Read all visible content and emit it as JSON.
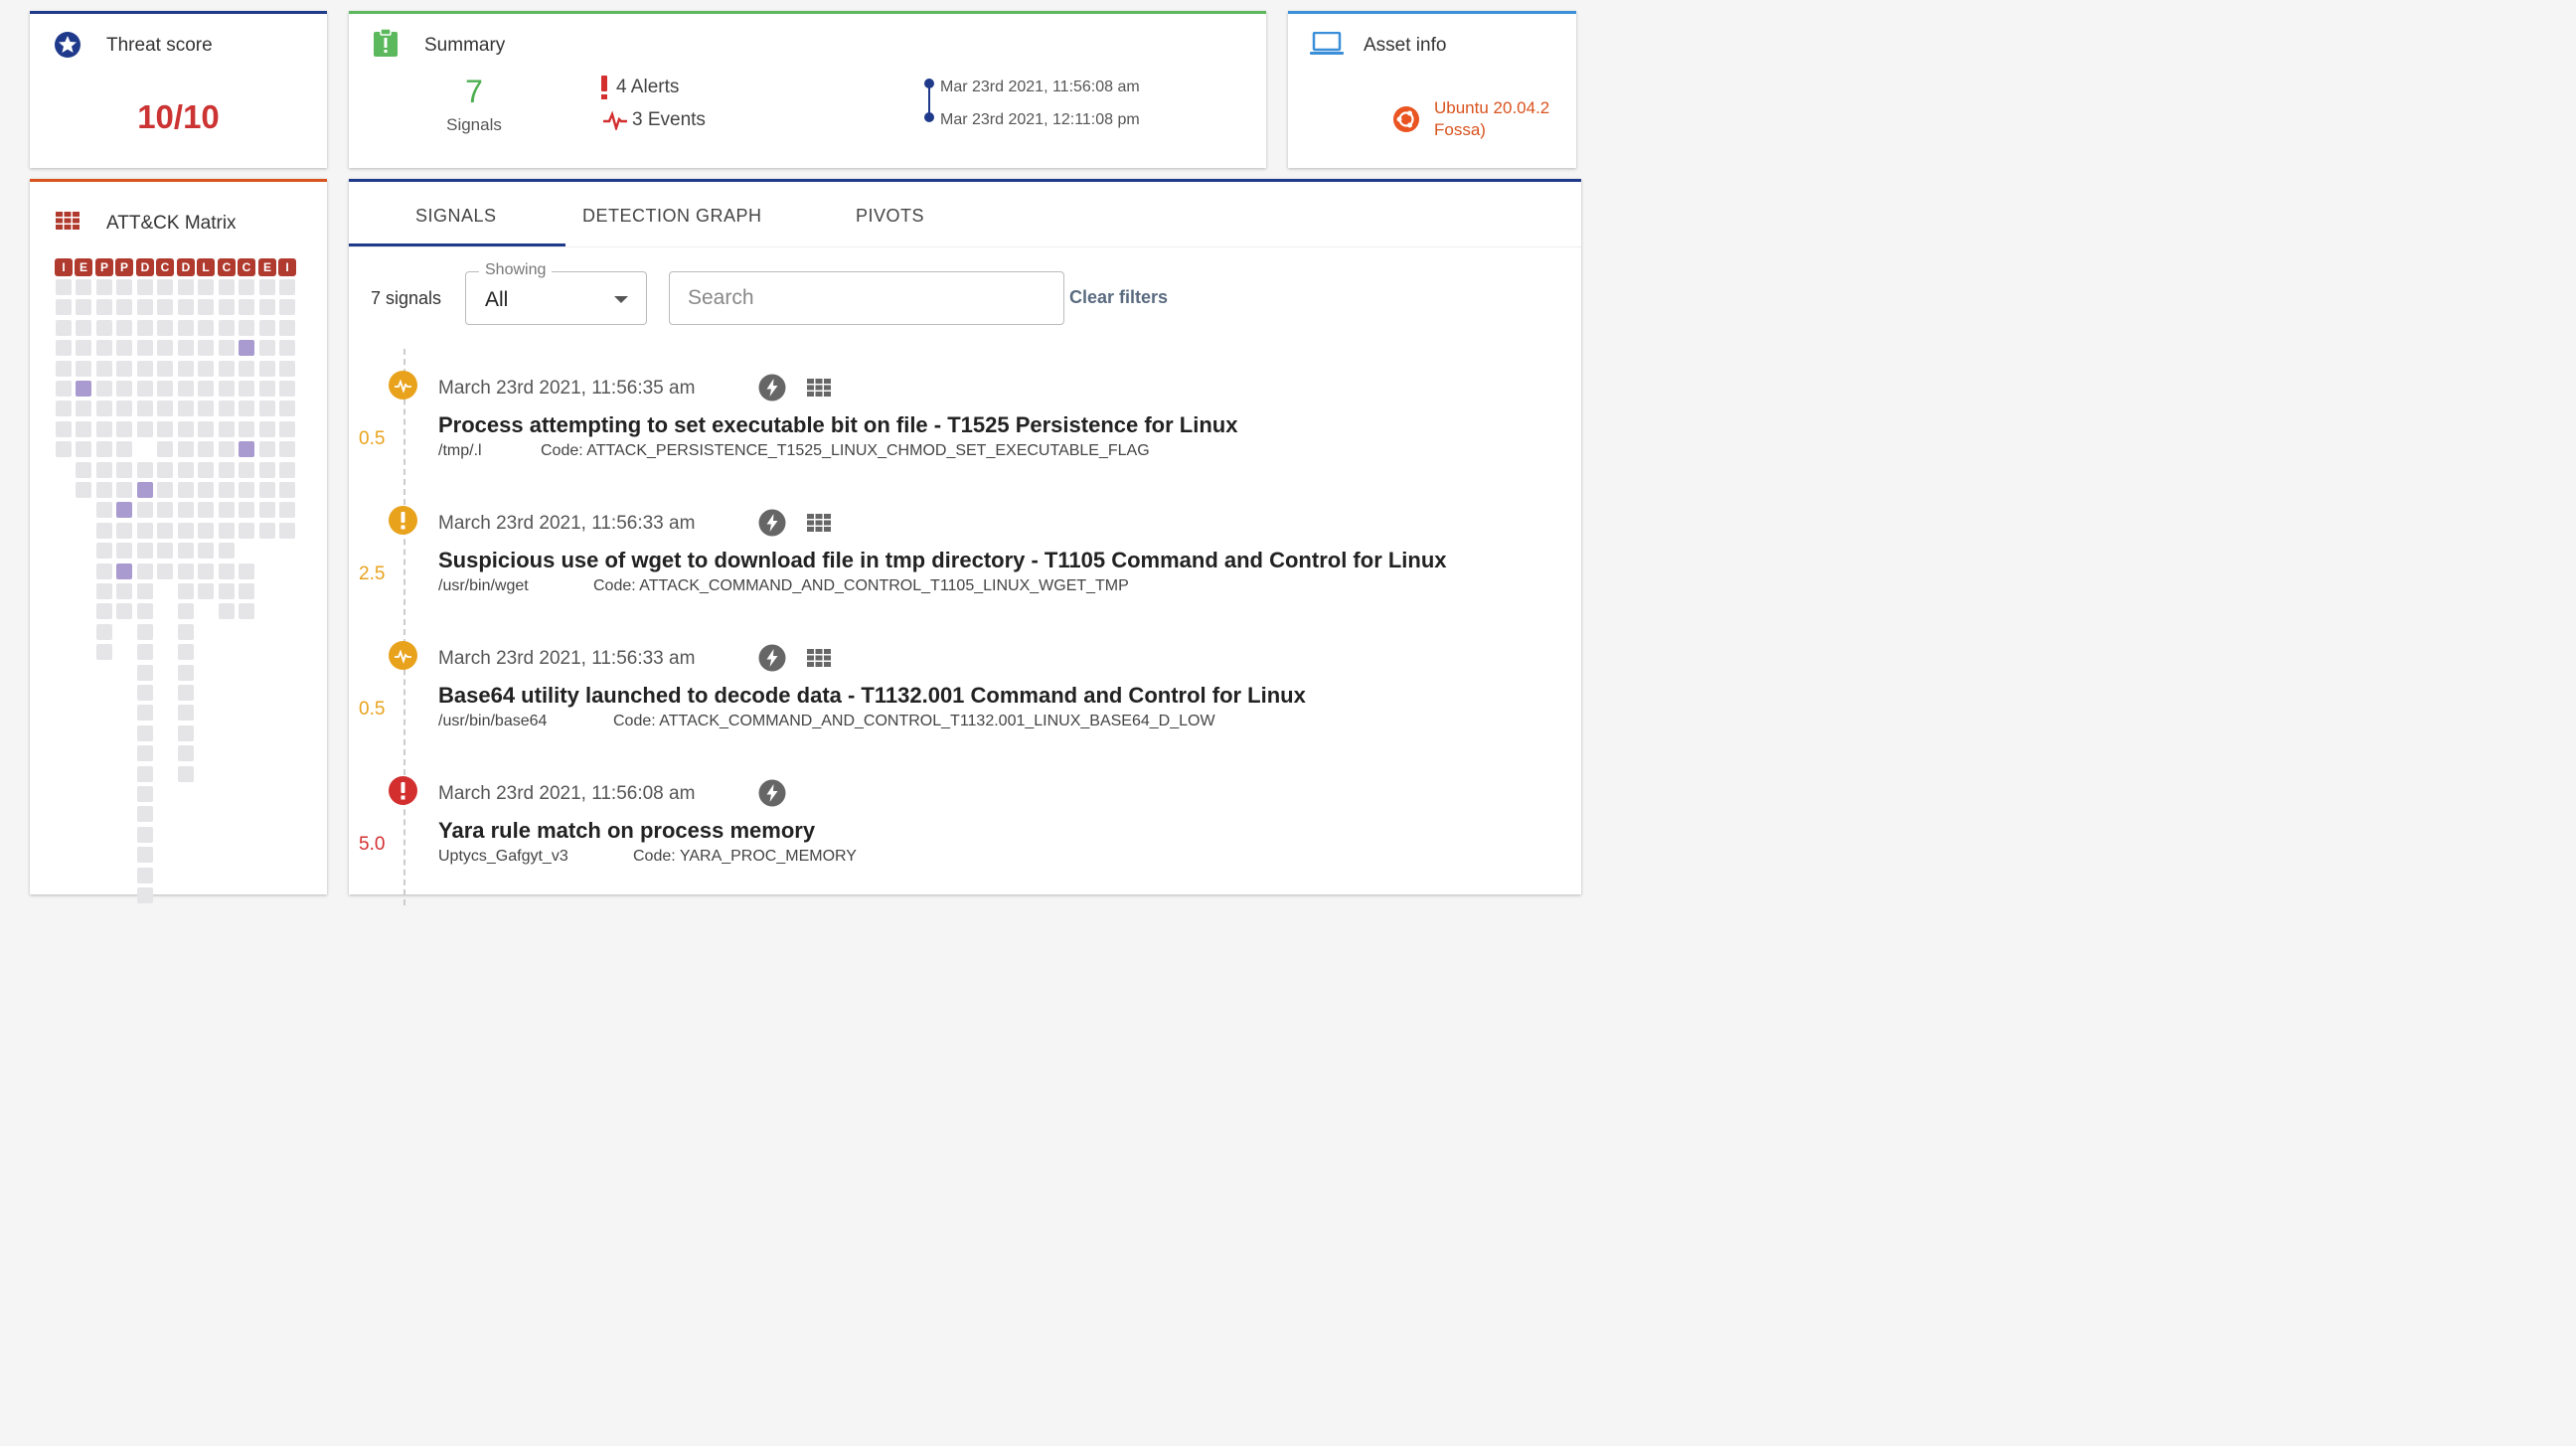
{
  "threat": {
    "title": "Threat score",
    "score": "10/10"
  },
  "summary": {
    "title": "Summary",
    "signal_count": "7",
    "signal_label": "Signals",
    "alerts": "4 Alerts",
    "events": "3 Events",
    "start_time": "Mar 23rd 2021, 11:56:08 am",
    "end_time": "Mar 23rd 2021, 12:11:08 pm"
  },
  "asset": {
    "title": "Asset info",
    "os": "Ubuntu 20.04.2\nFossa)"
  },
  "matrix": {
    "title": "ATT&CK Matrix",
    "tactics": [
      "I",
      "E",
      "P",
      "P",
      "D",
      "C",
      "D",
      "L",
      "C",
      "C",
      "E",
      "I"
    ],
    "column_heights": [
      10,
      11,
      19,
      17,
      31,
      15,
      25,
      16,
      17,
      17,
      13,
      13
    ]
  },
  "tabs": [
    "SIGNALS",
    "DETECTION GRAPH",
    "PIVOTS"
  ],
  "filters": {
    "count_label": "7 signals",
    "showing_label": "Showing",
    "showing_value": "All",
    "search_placeholder": "Search",
    "clear_label": "Clear filters"
  },
  "signals": [
    {
      "score": "0.5",
      "severity": "low",
      "kind": "event",
      "time": "March 23rd 2021, 11:56:35 am",
      "title": "Process attempting to set executable bit on file - T1525 Persistence for Linux",
      "path": "/tmp/.l",
      "code": "Code: ATTACK_PERSISTENCE_T1525_LINUX_CHMOD_SET_EXECUTABLE_FLAG",
      "has_matrix": true
    },
    {
      "score": "2.5",
      "severity": "medium",
      "kind": "alert",
      "time": "March 23rd 2021, 11:56:33 am",
      "title": "Suspicious use of wget to download file in tmp directory - T1105 Command and Control for Linux",
      "path": "/usr/bin/wget",
      "code": "Code: ATTACK_COMMAND_AND_CONTROL_T1105_LINUX_WGET_TMP",
      "has_matrix": true
    },
    {
      "score": "0.5",
      "severity": "low",
      "kind": "event",
      "time": "March 23rd 2021, 11:56:33 am",
      "title": "Base64 utility launched to decode data - T1132.001 Command and Control for Linux",
      "path": "/usr/bin/base64",
      "code": "Code: ATTACK_COMMAND_AND_CONTROL_T1132.001_LINUX_BASE64_D_LOW",
      "has_matrix": true
    },
    {
      "score": "5.0",
      "severity": "high",
      "kind": "alert",
      "time": "March 23rd 2021, 11:56:08 am",
      "title": "Yara rule match on process memory",
      "path": "Uptycs_Gafgyt_v3",
      "code": "Code: YARA_PROC_MEMORY",
      "has_matrix": false
    }
  ],
  "colors": {
    "low": "#e8a21c",
    "medium": "#e8a21c",
    "high": "#d32f2f",
    "accent": "#1f3a8a"
  }
}
